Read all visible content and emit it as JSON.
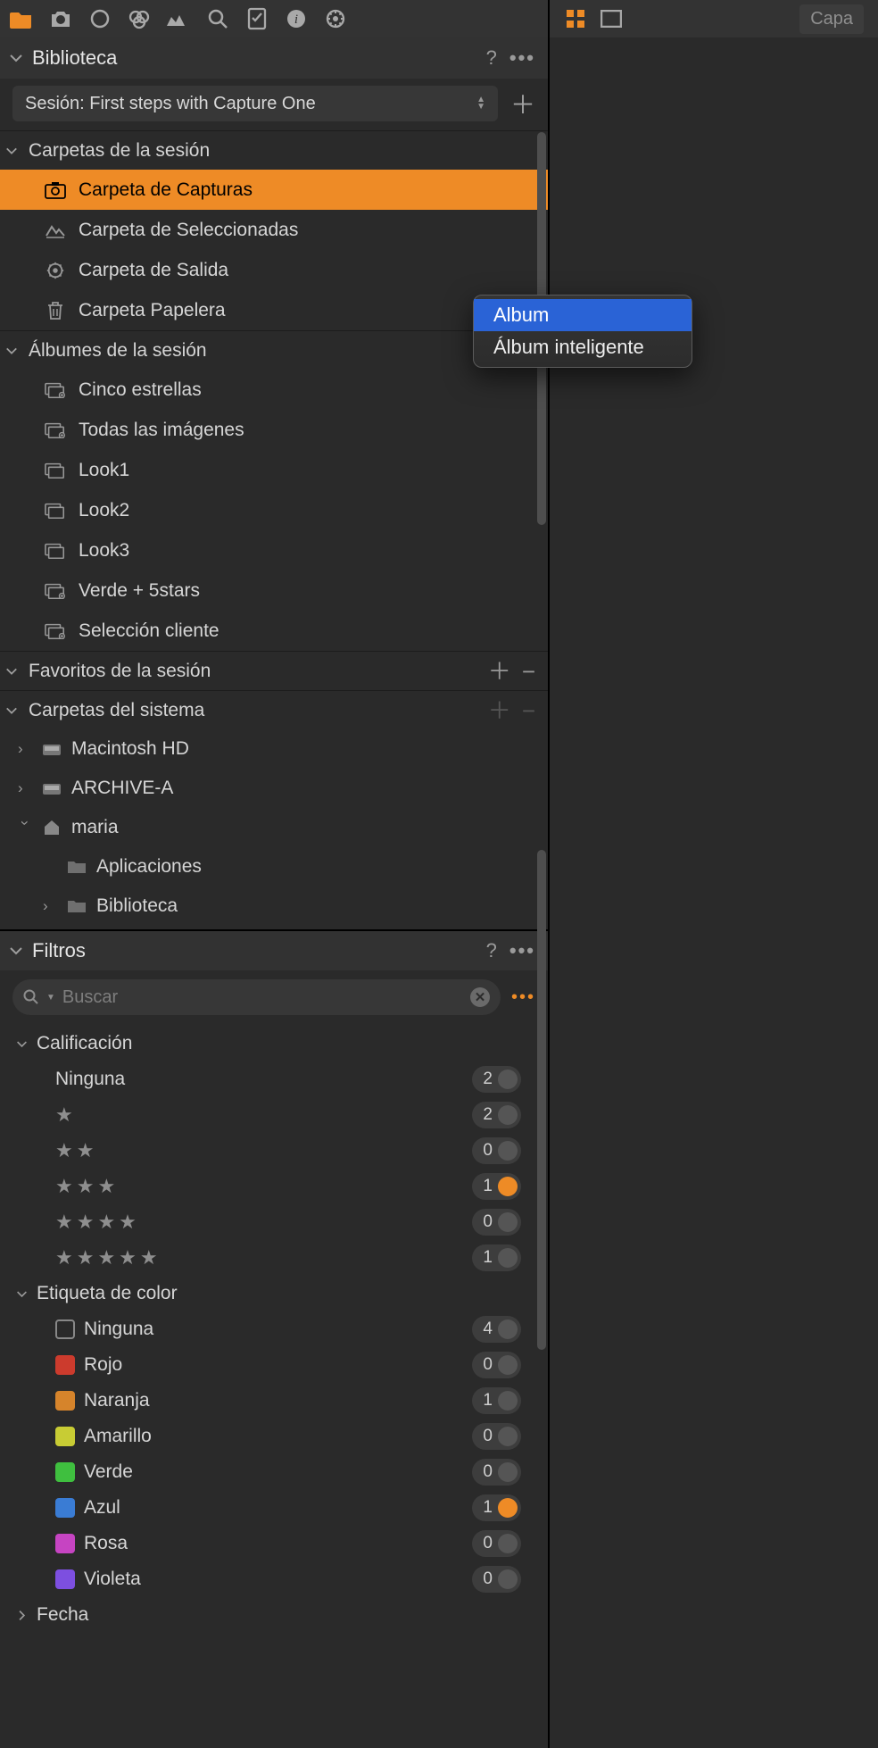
{
  "header": {
    "library_title": "Biblioteca",
    "session_label": "Sesión: First steps with Capture One"
  },
  "right_toolbar": {
    "capa_label": "Capa"
  },
  "session_folders": {
    "title": "Carpetas de la sesión",
    "items": [
      {
        "label": "Carpeta de Capturas"
      },
      {
        "label": "Carpeta de Seleccionadas"
      },
      {
        "label": "Carpeta de Salida"
      },
      {
        "label": "Carpeta Papelera"
      }
    ]
  },
  "session_albums": {
    "title": "Álbumes de la sesión",
    "items": [
      {
        "label": "Cinco estrellas"
      },
      {
        "label": "Todas las imágenes"
      },
      {
        "label": "Look1"
      },
      {
        "label": "Look2"
      },
      {
        "label": "Look3"
      },
      {
        "label": "Verde + 5stars"
      },
      {
        "label": "Selección cliente"
      }
    ]
  },
  "favorites": {
    "title": "Favoritos de la sesión"
  },
  "system_folders": {
    "title": "Carpetas del sistema",
    "items": [
      {
        "label": "Macintosh HD"
      },
      {
        "label": "ARCHIVE-A"
      },
      {
        "label": "maria"
      },
      {
        "label": "Aplicaciones"
      },
      {
        "label": "Biblioteca"
      }
    ]
  },
  "filters": {
    "title": "Filtros",
    "search_placeholder": "Buscar",
    "rating": {
      "title": "Calificación",
      "rows": [
        {
          "label": "Ninguna",
          "count": "2",
          "on": false
        },
        {
          "stars": 1,
          "count": "2",
          "on": false
        },
        {
          "stars": 2,
          "count": "0",
          "on": false
        },
        {
          "stars": 3,
          "count": "1",
          "on": true
        },
        {
          "stars": 4,
          "count": "0",
          "on": false
        },
        {
          "stars": 5,
          "count": "1",
          "on": false
        }
      ]
    },
    "color_tag": {
      "title": "Etiqueta de color",
      "rows": [
        {
          "label": "Ninguna",
          "swatch": "none",
          "count": "4",
          "on": false
        },
        {
          "label": "Rojo",
          "swatch": "#cc3b2d",
          "count": "0",
          "on": false
        },
        {
          "label": "Naranja",
          "swatch": "#d6842b",
          "count": "1",
          "on": false
        },
        {
          "label": "Amarillo",
          "swatch": "#c8cc34",
          "count": "0",
          "on": false
        },
        {
          "label": "Verde",
          "swatch": "#3fbf3f",
          "count": "0",
          "on": false
        },
        {
          "label": "Azul",
          "swatch": "#3a7cd4",
          "count": "1",
          "on": true
        },
        {
          "label": "Rosa",
          "swatch": "#c644c2",
          "count": "0",
          "on": false
        },
        {
          "label": "Violeta",
          "swatch": "#7d4fe0",
          "count": "0",
          "on": false
        }
      ]
    },
    "date": {
      "title": "Fecha"
    }
  },
  "context_menu": {
    "items": [
      {
        "label": "Album"
      },
      {
        "label": "Álbum inteligente"
      }
    ]
  }
}
